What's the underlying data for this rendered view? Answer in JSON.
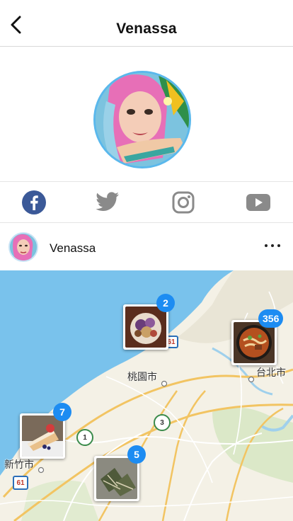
{
  "header": {
    "title": "Venassa",
    "back_icon": "chevron-left-icon"
  },
  "profile": {
    "avatar": "profile-avatar",
    "ring_color": "#5ab8ec"
  },
  "social": [
    {
      "name": "facebook",
      "icon": "facebook-icon",
      "color": "#3b5998"
    },
    {
      "name": "twitter",
      "icon": "twitter-icon",
      "color": "#8a8a8a"
    },
    {
      "name": "instagram",
      "icon": "instagram-icon",
      "color": "#8a8a8a"
    },
    {
      "name": "youtube",
      "icon": "youtube-icon",
      "color": "#8a8a8a"
    }
  ],
  "post": {
    "user": "Venassa",
    "more_icon": "more-horizontal-icon"
  },
  "map": {
    "labels": {
      "taoyuan": "桃園市",
      "taipei": "台北市",
      "hsinchu": "新竹市",
      "route_61_top": "61",
      "route_61_bottom": "61",
      "route_1": "1",
      "route_3": "3"
    },
    "pins": [
      {
        "count": "2",
        "subject": "food-plate"
      },
      {
        "count": "356",
        "subject": "noodle-soup"
      },
      {
        "count": "7",
        "subject": "cake-slice"
      },
      {
        "count": "5",
        "subject": "rice-dumplings"
      }
    ],
    "badge_color": "#1d8cf2"
  }
}
